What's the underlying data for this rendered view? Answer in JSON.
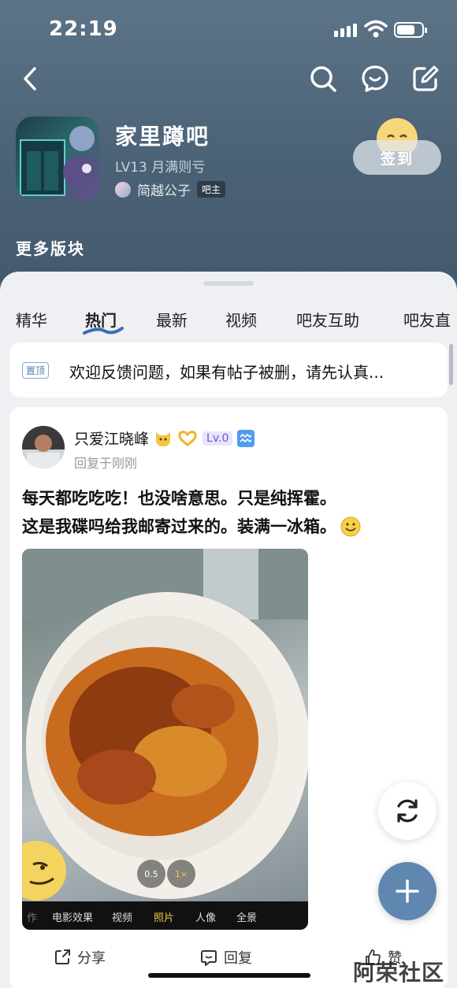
{
  "status_bar": {
    "time": "22:19"
  },
  "forum": {
    "name": "家里蹲吧",
    "level": "LV13 月满则亏",
    "owner_name": "简越公子",
    "owner_badge": "吧主",
    "signin_label": "签到",
    "more_sections": "更多版块"
  },
  "tabs": [
    "精华",
    "热门",
    "最新",
    "视频",
    "吧友互助",
    "吧友直"
  ],
  "active_tab": "热门",
  "pinned": {
    "badge": "置顶",
    "text": "欢迎反馈问题，如果有帖子被删，请先认真..."
  },
  "post": {
    "author": "只爱江晓峰",
    "level_badge": "Lv.0",
    "reply_time": "回复于刚刚",
    "body_line1": "每天都吃吃吃！也没啥意思。只是纯挥霍。",
    "body_line2": "这是我碟吗给我邮寄过来的。装满一冰箱。",
    "photo_modes": [
      "作",
      "电影效果",
      "视频",
      "照片",
      "人像",
      "全景"
    ],
    "photo_active_mode": "照片",
    "zoom_levels": [
      "0.5",
      "1×"
    ],
    "actions": {
      "share": "分享",
      "reply": "回复",
      "like": "赞"
    }
  },
  "watermark": "阿荣社区",
  "colors": {
    "header_bg": "#4a6176",
    "accent": "#5f87b0",
    "active_mode": "#f5c542"
  }
}
